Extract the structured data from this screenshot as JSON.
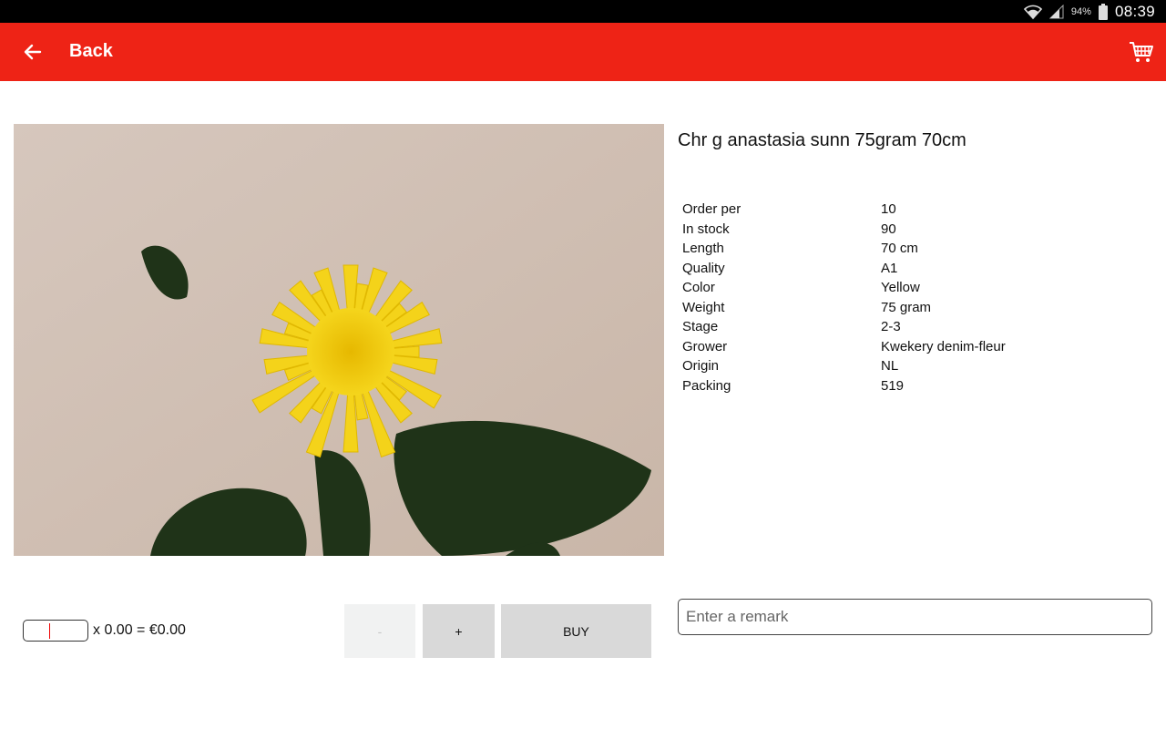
{
  "status_bar": {
    "battery_percent": "94%",
    "time": "08:39",
    "icons": [
      "wifi-icon",
      "signal-icon",
      "battery-icon"
    ]
  },
  "app_bar": {
    "back_label": "Back",
    "back_icon": "arrow-left-icon",
    "cart_icon": "shopping-cart-icon",
    "color": "#ee2316"
  },
  "product": {
    "title": "Chr g anastasia sunn 75gram 70cm",
    "image": "yellow-chrysanthemum-photo",
    "specs": [
      {
        "label": "Order per",
        "value": "10"
      },
      {
        "label": "In stock",
        "value": "90"
      },
      {
        "label": "Length",
        "value": "70 cm"
      },
      {
        "label": "Quality",
        "value": "A1"
      },
      {
        "label": "Color",
        "value": "Yellow"
      },
      {
        "label": "Weight",
        "value": "75 gram"
      },
      {
        "label": "Stage",
        "value": "2-3"
      },
      {
        "label": "Grower",
        "value": "Kwekery denim-fleur"
      },
      {
        "label": "Origin",
        "value": "NL"
      },
      {
        "label": "Packing",
        "value": "519"
      }
    ]
  },
  "order": {
    "quantity_value": "",
    "price_calc": "x 0.00 = €0.00",
    "minus_label": "-",
    "plus_label": "+",
    "buy_label": "BUY",
    "remark_placeholder": "Enter a remark"
  }
}
